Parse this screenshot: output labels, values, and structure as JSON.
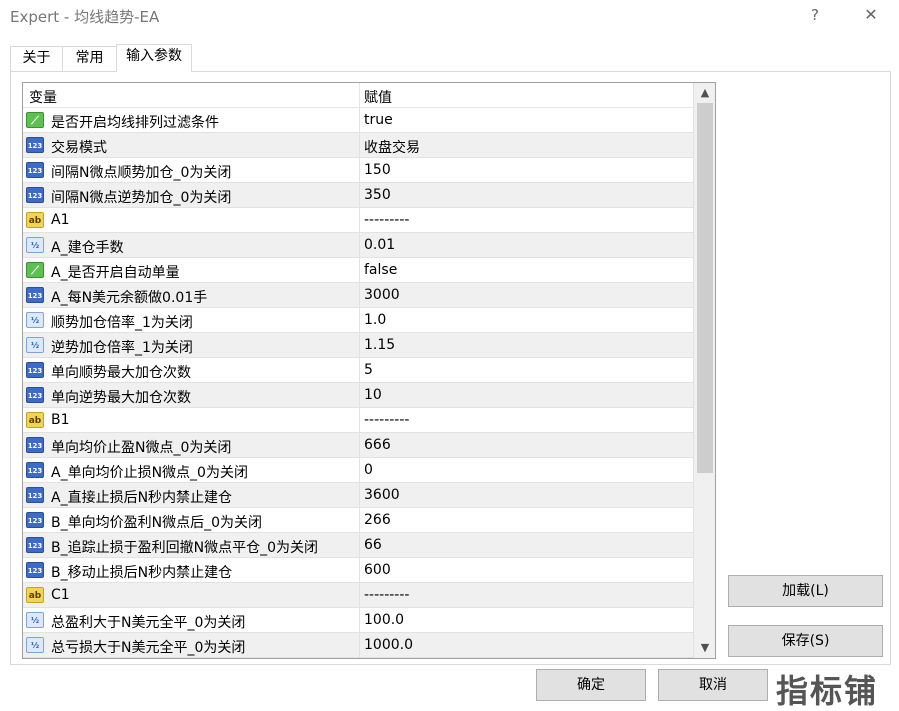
{
  "window": {
    "title": "Expert - 均线趋势-EA",
    "help_glyph": "?",
    "close_glyph": "✕"
  },
  "tabs": [
    {
      "label": "关于"
    },
    {
      "label": "常用"
    },
    {
      "label": "输入参数"
    }
  ],
  "grid": {
    "col_variable": "变量",
    "col_value": "赋值",
    "rows": [
      {
        "type": "bool",
        "icon": "bool-icon",
        "name": "是否开启均线排列过滤条件",
        "value": "true"
      },
      {
        "type": "int",
        "icon": "int-icon",
        "name": "交易模式",
        "value": "收盘交易"
      },
      {
        "type": "int",
        "icon": "int-icon",
        "name": "间隔N微点顺势加仓_0为关闭",
        "value": "150"
      },
      {
        "type": "int",
        "icon": "int-icon",
        "name": "间隔N微点逆势加仓_0为关闭",
        "value": "350"
      },
      {
        "type": "str",
        "icon": "string-icon",
        "name": "A1",
        "value": "---------"
      },
      {
        "type": "dbl",
        "icon": "double-icon",
        "name": "A_建仓手数",
        "value": "0.01"
      },
      {
        "type": "bool",
        "icon": "bool-icon",
        "name": "A_是否开启自动单量",
        "value": "false"
      },
      {
        "type": "int",
        "icon": "int-icon",
        "name": "A_每N美元余额做0.01手",
        "value": "3000"
      },
      {
        "type": "dbl",
        "icon": "double-icon",
        "name": "顺势加仓倍率_1为关闭",
        "value": "1.0"
      },
      {
        "type": "dbl",
        "icon": "double-icon",
        "name": "逆势加仓倍率_1为关闭",
        "value": "1.15"
      },
      {
        "type": "int",
        "icon": "int-icon",
        "name": "单向顺势最大加仓次数",
        "value": "5"
      },
      {
        "type": "int",
        "icon": "int-icon",
        "name": "单向逆势最大加仓次数",
        "value": "10"
      },
      {
        "type": "str",
        "icon": "string-icon",
        "name": "B1",
        "value": "---------"
      },
      {
        "type": "int",
        "icon": "int-icon",
        "name": "单向均价止盈N微点_0为关闭",
        "value": "666"
      },
      {
        "type": "int",
        "icon": "int-icon",
        "name": "A_单向均价止损N微点_0为关闭",
        "value": "0"
      },
      {
        "type": "int",
        "icon": "int-icon",
        "name": "A_直接止损后N秒内禁止建仓",
        "value": "3600"
      },
      {
        "type": "int",
        "icon": "int-icon",
        "name": "B_单向均价盈利N微点后_0为关闭",
        "value": "266"
      },
      {
        "type": "int",
        "icon": "int-icon",
        "name": "B_追踪止损于盈利回撤N微点平仓_0为关闭",
        "value": "66"
      },
      {
        "type": "int",
        "icon": "int-icon",
        "name": "B_移动止损后N秒内禁止建仓",
        "value": "600"
      },
      {
        "type": "str",
        "icon": "string-icon",
        "name": "C1",
        "value": "---------"
      },
      {
        "type": "dbl",
        "icon": "double-icon",
        "name": "总盈利大于N美元全平_0为关闭",
        "value": "100.0"
      },
      {
        "type": "dbl",
        "icon": "double-icon",
        "name": "总亏损大于N美元全平_0为关闭",
        "value": "1000.0"
      }
    ],
    "icon_glyphs": {
      "bool": "⟋",
      "int": "123",
      "str": "ab",
      "dbl": "½"
    }
  },
  "scrollbar": {
    "up_glyph": "▲",
    "down_glyph": "▼"
  },
  "buttons": {
    "load": "加载(L)",
    "save": "保存(S)",
    "ok": "确定",
    "cancel": "取消"
  },
  "watermark": "指标铺"
}
